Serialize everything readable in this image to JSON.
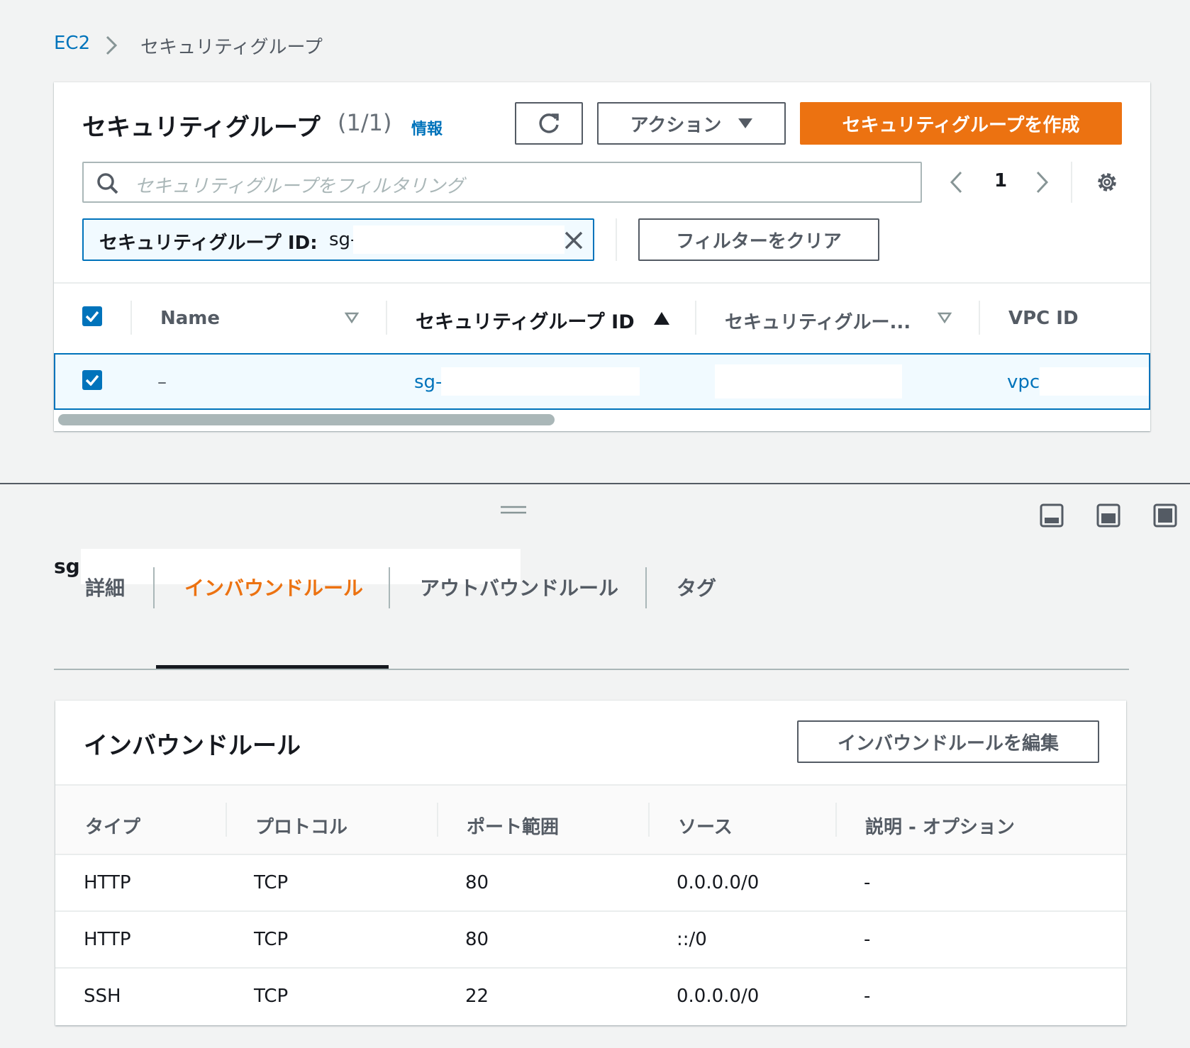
{
  "breadcrumb": {
    "root": "EC2",
    "current": "セキュリティグループ"
  },
  "panel": {
    "title": "セキュリティグループ",
    "count": "(1/1)",
    "info_link": "情報",
    "actions_label": "アクション",
    "create_label": "セキュリティグループを作成",
    "search_placeholder": "セキュリティグループをフィルタリング",
    "page_number": "1",
    "filter_token_key": "セキュリティグループ ID:",
    "filter_token_value": "sg-",
    "clear_filters_label": "フィルターをクリア",
    "columns": [
      "Name",
      "セキュリティグループ ID",
      "セキュリティグルー...",
      "VPC ID"
    ],
    "row": {
      "name": "–",
      "sg_id": "sg-",
      "vpc_id": "vpc"
    }
  },
  "detail": {
    "sg_id": "sg-",
    "tabs": [
      "詳細",
      "インバウンドルール",
      "アウトバウンドルール",
      "タグ"
    ],
    "active_tab": "インバウンドルール",
    "section_title": "インバウンドルール",
    "edit_label": "インバウンドルールを編集",
    "columns": [
      "タイプ",
      "プロトコル",
      "ポート範囲",
      "ソース",
      "説明 - オプション"
    ],
    "rules": [
      {
        "type": "HTTP",
        "protocol": "TCP",
        "port": "80",
        "source": "0.0.0.0/0",
        "desc": "-"
      },
      {
        "type": "HTTP",
        "protocol": "TCP",
        "port": "80",
        "source": "::/0",
        "desc": "-"
      },
      {
        "type": "SSH",
        "protocol": "TCP",
        "port": "22",
        "source": "0.0.0.0/0",
        "desc": "-"
      }
    ]
  },
  "colors": {
    "accent": "#ec7211",
    "link": "#0073bb",
    "selected_row": "#f1faff"
  },
  "icons": [
    "chevron-right-icon",
    "refresh-icon",
    "caret-down-icon",
    "search-icon",
    "chevron-left-icon",
    "gear-icon",
    "close-icon",
    "checkbox-icon",
    "sort-asc-icon",
    "filter-caret-icon",
    "drag-handle-icon",
    "layout-bottom-icon",
    "layout-side-icon",
    "layout-full-icon"
  ]
}
